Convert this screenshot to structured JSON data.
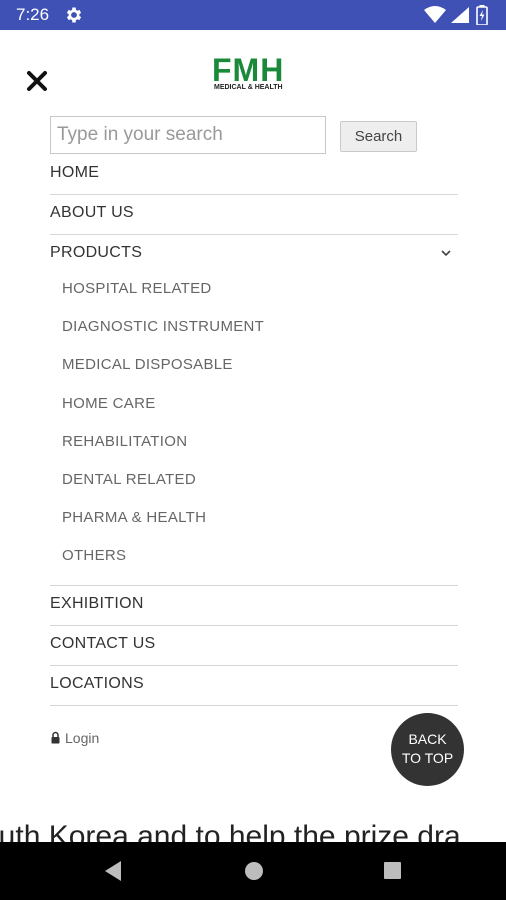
{
  "status_bar": {
    "time": "7:26",
    "icons": [
      "gear-icon",
      "wifi-icon",
      "signal-icon",
      "battery-icon"
    ],
    "background": "#3f51b5"
  },
  "header": {
    "close_icon": "close-icon",
    "logo": {
      "main": "FMH",
      "sub": "MEDICAL & HEALTH",
      "color": "#1a8a3a"
    }
  },
  "search": {
    "placeholder": "Type in your search",
    "value": "",
    "button_label": "Search"
  },
  "menu": {
    "home": "HOME",
    "about": "ABOUT US",
    "products": {
      "label": "PRODUCTS",
      "expanded": true,
      "icon": "chevron-down-icon",
      "subitems": [
        "HOSPITAL RELATED",
        "DIAGNOSTIC INSTRUMENT",
        "MEDICAL DISPOSABLE",
        "HOME CARE",
        "REHABILITATION",
        "DENTAL RELATED",
        "PHARMA & HEALTH",
        "OTHERS"
      ]
    },
    "exhibition": "EXHIBITION",
    "contact": "CONTACT US",
    "locations": "LOCATIONS"
  },
  "login": {
    "label": "Login",
    "icon": "lock-icon"
  },
  "back_to_top": {
    "line1": "BACK",
    "line2": "TO TOP"
  },
  "page_text": "outh Korea and to help the prize dra",
  "nav_bar": {
    "icons": [
      "back-icon",
      "home-icon",
      "recents-icon"
    ]
  }
}
